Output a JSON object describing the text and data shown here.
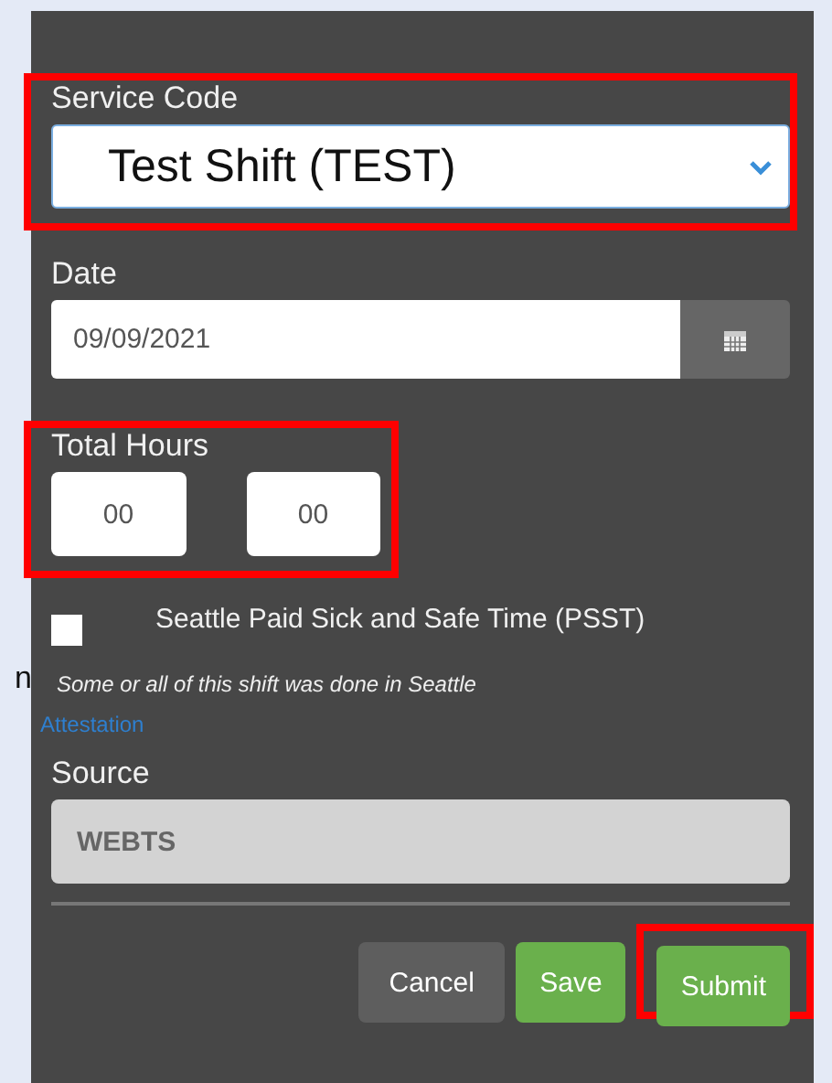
{
  "outside_text": "n",
  "service_code": {
    "label": "Service Code",
    "value": "Test Shift (TEST)",
    "highlighted": true
  },
  "date": {
    "label": "Date",
    "value": "09/09/2021"
  },
  "total_hours": {
    "label": "Total Hours",
    "hours": "00",
    "minutes": "00",
    "highlighted": true
  },
  "psst": {
    "label": "Seattle Paid Sick and Safe Time (PSST)",
    "checked": false,
    "note": "Some or all of this shift was done in Seattle"
  },
  "attestation_link": "Attestation",
  "source": {
    "label": "Source",
    "value": "WEBTS"
  },
  "buttons": [
    {
      "label": "Cancel",
      "kind": "cancel",
      "highlighted": false
    },
    {
      "label": "Save",
      "kind": "primary",
      "highlighted": false
    },
    {
      "label": "Submit",
      "kind": "primary",
      "highlighted": true
    }
  ]
}
